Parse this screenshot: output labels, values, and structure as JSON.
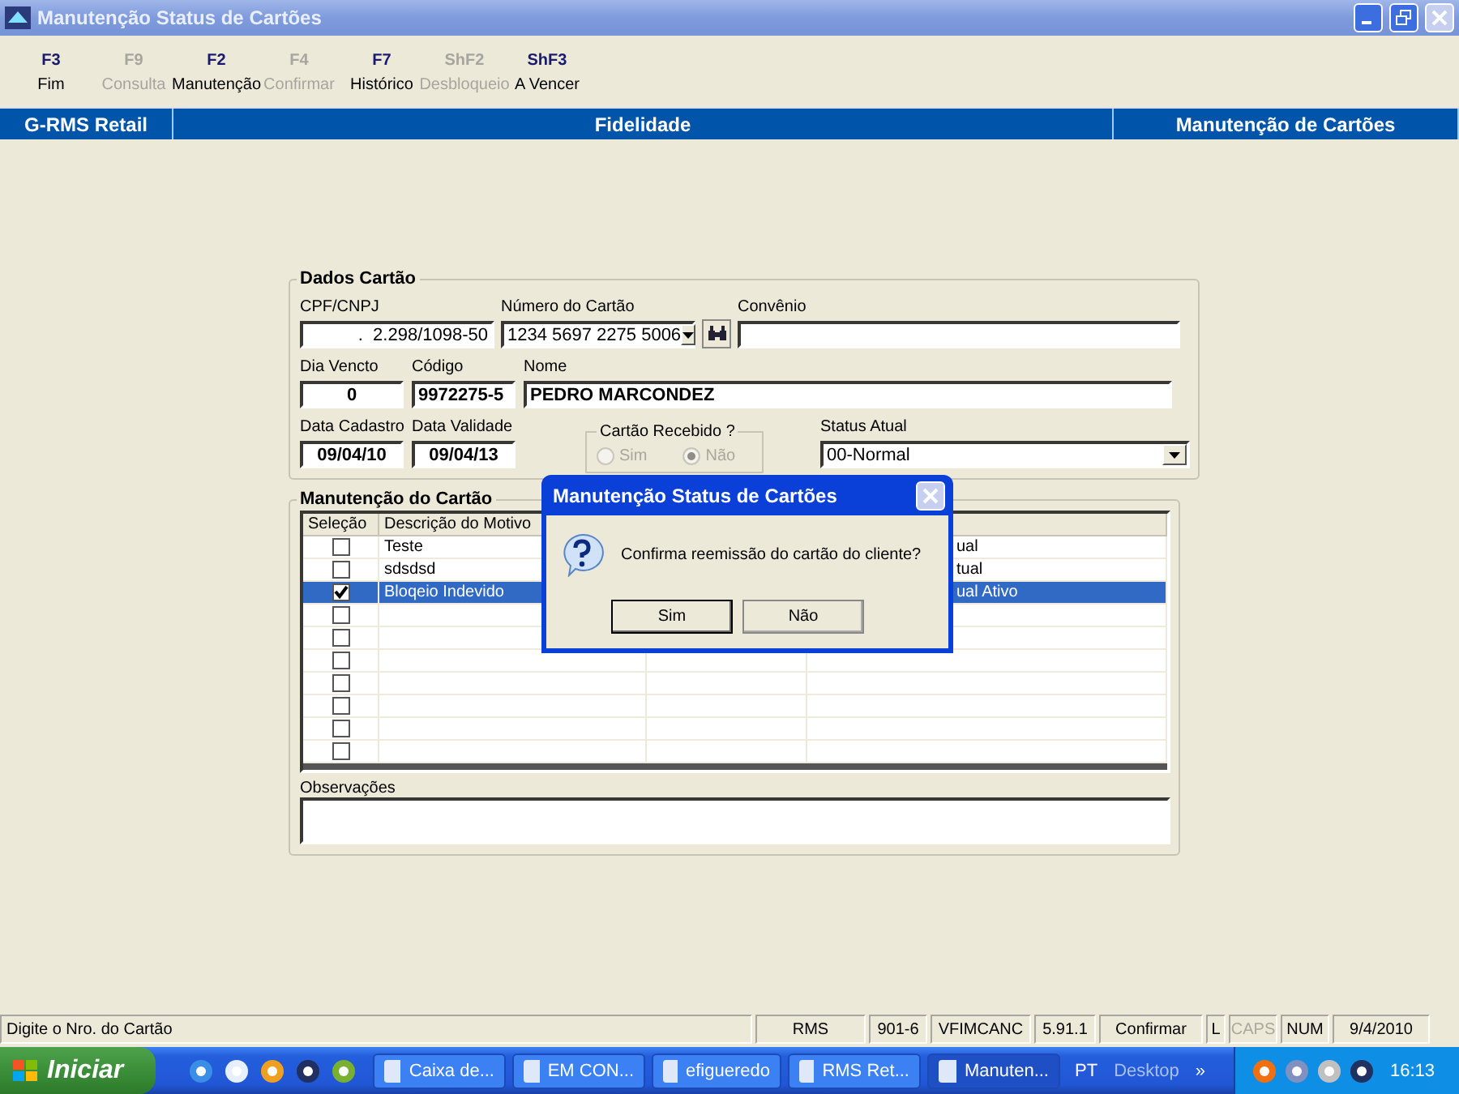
{
  "window": {
    "title": "Manutenção Status de Cartões"
  },
  "toolbar": [
    {
      "key": "F3",
      "label": "Fim",
      "disabled": false
    },
    {
      "key": "F9",
      "label": "Consulta",
      "disabled": true
    },
    {
      "key": "F2",
      "label": "Manutenção",
      "disabled": false
    },
    {
      "key": "F4",
      "label": "Confirmar",
      "disabled": true
    },
    {
      "key": "F7",
      "label": "Histórico",
      "disabled": false
    },
    {
      "key": "ShF2",
      "label": "Desbloqueio",
      "disabled": true
    },
    {
      "key": "ShF3",
      "label": "A Vencer",
      "disabled": false
    }
  ],
  "header": {
    "system": "G-RMS Retail",
    "module": "Fidelidade",
    "screen": "Manutenção de Cartões"
  },
  "card_data": {
    "title": "Dados Cartão",
    "cpf": {
      "label": "CPF/CNPJ",
      "value": ".  2.298/1098-50"
    },
    "card_number": {
      "label": "Número do Cartão",
      "value": "1234 5697 2275 5006"
    },
    "agreement": {
      "label": "Convênio"
    },
    "due_day": {
      "label": "Dia Vencto",
      "value": "0"
    },
    "code": {
      "label": "Código",
      "value": "9972275-5"
    },
    "name": {
      "label": "Nome",
      "value": "PEDRO MARCONDEZ"
    },
    "registration_date": {
      "label": "Data Cadastro",
      "value": "09/04/10"
    },
    "expiry_date": {
      "label": "Data Validade",
      "value": "09/04/13"
    },
    "card_received": {
      "title": "Cartão Recebido ?",
      "disabled": true,
      "options": [
        {
          "label": "Sim",
          "selected": false
        },
        {
          "label": "Não",
          "selected": true
        }
      ]
    },
    "status": {
      "label": "Status Atual",
      "value": "00-Normal"
    }
  },
  "maintenance": {
    "title": "Manutenção do Cartão",
    "columns": [
      "Seleção",
      "Descrição do Motivo"
    ],
    "rows": [
      {
        "checked": false,
        "selected": false,
        "description": "Teste",
        "column_4": "ual"
      },
      {
        "checked": false,
        "selected": false,
        "description": "sdsdsd",
        "column_4": "tual"
      },
      {
        "checked": true,
        "selected": true,
        "description": "Bloqeio Indevido",
        "column_4": "ual Ativo"
      },
      {
        "checked": false,
        "selected": false
      },
      {
        "checked": false,
        "selected": false
      },
      {
        "checked": false,
        "selected": false
      },
      {
        "checked": false,
        "selected": false
      },
      {
        "checked": false,
        "selected": false
      },
      {
        "checked": false,
        "selected": false
      },
      {
        "checked": false,
        "selected": false
      }
    ],
    "notes_label": "Observações"
  },
  "dialog": {
    "title": "Manutenção Status de Cartões",
    "message": "Confirma reemissão do cartão do cliente?",
    "buttons": [
      {
        "label": "Sim",
        "selected": true
      },
      {
        "label": "Não",
        "selected": false
      }
    ]
  },
  "status_bar": [
    {
      "text": "Digite o Nro. do Cartão",
      "disabled": false
    },
    {
      "text": "RMS",
      "disabled": false
    },
    {
      "text": "901-6",
      "disabled": false
    },
    {
      "text": "VFIMCANC",
      "disabled": false
    },
    {
      "text": "5.91.1",
      "disabled": false
    },
    {
      "text": "Confirmar",
      "disabled": false
    },
    {
      "text": "L",
      "disabled": false
    },
    {
      "text": "CAPS",
      "disabled": true
    },
    {
      "text": "NUM",
      "disabled": false
    },
    {
      "text": "9/4/2010",
      "disabled": false
    }
  ],
  "taskbar": {
    "start": "Iniciar",
    "tasks": [
      {
        "label": "Caixa de...",
        "selected": false
      },
      {
        "label": "EM CON...",
        "selected": false
      },
      {
        "label": "efigueredo",
        "selected": false
      },
      {
        "label": "RMS Ret...",
        "selected": false
      },
      {
        "label": "Manuten...",
        "selected": true
      }
    ],
    "language": "PT",
    "desktop": "Desktop",
    "more": "»",
    "clock": "16:13"
  }
}
